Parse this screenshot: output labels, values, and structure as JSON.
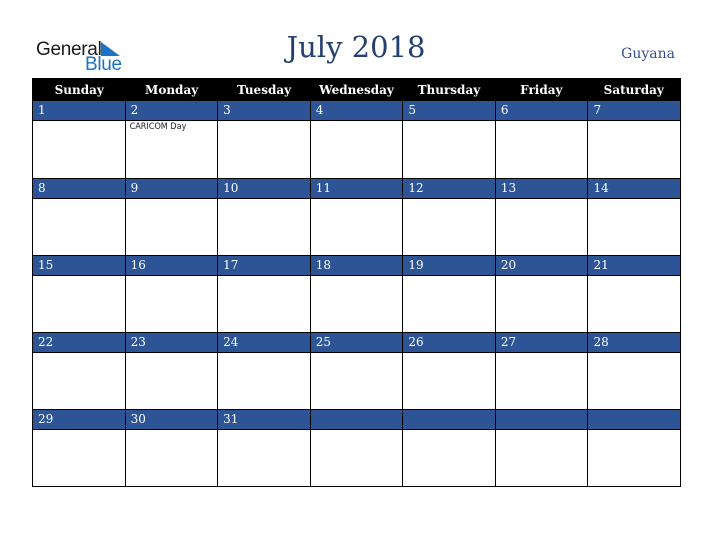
{
  "logo": {
    "word1": "General",
    "word2": "Blue"
  },
  "header": {
    "title": "July 2018",
    "country": "Guyana"
  },
  "colors": {
    "band": "#2d5494",
    "title": "#25406e",
    "logo_blue": "#1a73c4"
  },
  "weekdays": [
    "Sunday",
    "Monday",
    "Tuesday",
    "Wednesday",
    "Thursday",
    "Friday",
    "Saturday"
  ],
  "weeks": [
    [
      {
        "day": "1",
        "event": ""
      },
      {
        "day": "2",
        "event": "CARICOM Day"
      },
      {
        "day": "3",
        "event": ""
      },
      {
        "day": "4",
        "event": ""
      },
      {
        "day": "5",
        "event": ""
      },
      {
        "day": "6",
        "event": ""
      },
      {
        "day": "7",
        "event": ""
      }
    ],
    [
      {
        "day": "8",
        "event": ""
      },
      {
        "day": "9",
        "event": ""
      },
      {
        "day": "10",
        "event": ""
      },
      {
        "day": "11",
        "event": ""
      },
      {
        "day": "12",
        "event": ""
      },
      {
        "day": "13",
        "event": ""
      },
      {
        "day": "14",
        "event": ""
      }
    ],
    [
      {
        "day": "15",
        "event": ""
      },
      {
        "day": "16",
        "event": ""
      },
      {
        "day": "17",
        "event": ""
      },
      {
        "day": "18",
        "event": ""
      },
      {
        "day": "19",
        "event": ""
      },
      {
        "day": "20",
        "event": ""
      },
      {
        "day": "21",
        "event": ""
      }
    ],
    [
      {
        "day": "22",
        "event": ""
      },
      {
        "day": "23",
        "event": ""
      },
      {
        "day": "24",
        "event": ""
      },
      {
        "day": "25",
        "event": ""
      },
      {
        "day": "26",
        "event": ""
      },
      {
        "day": "27",
        "event": ""
      },
      {
        "day": "28",
        "event": ""
      }
    ],
    [
      {
        "day": "29",
        "event": ""
      },
      {
        "day": "30",
        "event": ""
      },
      {
        "day": "31",
        "event": ""
      },
      {
        "day": "",
        "event": ""
      },
      {
        "day": "",
        "event": ""
      },
      {
        "day": "",
        "event": ""
      },
      {
        "day": "",
        "event": ""
      }
    ]
  ]
}
